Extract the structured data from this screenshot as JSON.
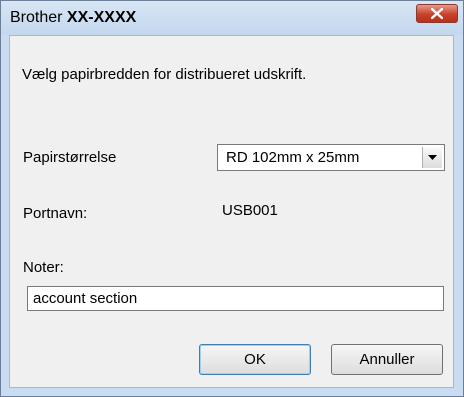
{
  "window": {
    "title_prefix": "Brother ",
    "title_model": "XX-XXXX"
  },
  "dialog": {
    "instruction": "Vælg papirbredden for distribueret udskrift.",
    "paper_size_label": "Papirstørrelse",
    "paper_size_value": "RD 102mm x 25mm",
    "port_label": "Portnavn:",
    "port_value": "USB001",
    "notes_label": "Noter:",
    "notes_value": "account section"
  },
  "buttons": {
    "ok": "OK",
    "cancel": "Annuller"
  },
  "icons": {
    "close": "close-icon",
    "dropdown": "chevron-down-icon"
  },
  "colors": {
    "title_bar": "#c9dcf1",
    "close_button": "#c7422a",
    "dialog_background": "#f0f0f0"
  }
}
